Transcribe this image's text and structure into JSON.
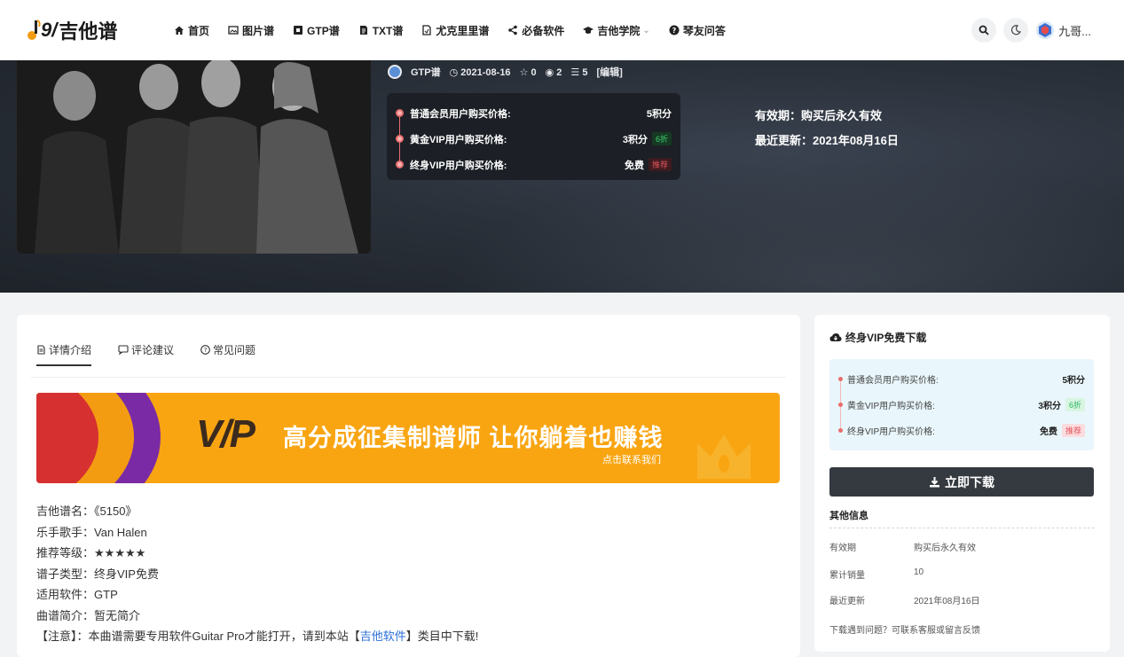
{
  "header": {
    "logo_text": "吉他谱",
    "nav": [
      {
        "label": "首页",
        "icon": "home-icon"
      },
      {
        "label": "图片谱",
        "icon": "image-icon"
      },
      {
        "label": "GTP谱",
        "icon": "gtp-icon"
      },
      {
        "label": "TXT谱",
        "icon": "file-text-icon"
      },
      {
        "label": "尤克里里谱",
        "icon": "file-icon"
      },
      {
        "label": "必备软件",
        "icon": "share-icon"
      },
      {
        "label": "吉他学院",
        "icon": "graduation-cap-icon",
        "dropdown": true
      },
      {
        "label": "琴友问答",
        "icon": "question-icon"
      }
    ],
    "user_name": "九哥..."
  },
  "hero": {
    "category": "GTP谱",
    "date": "2021-08-16",
    "stars": "0",
    "views": "2",
    "likes": "5",
    "edit": "[编辑]",
    "prices": [
      {
        "label": "普通会员用户购买价格:",
        "value": "5积分",
        "badge": ""
      },
      {
        "label": "黄金VIP用户购买价格:",
        "value": "3积分",
        "badge": "6折"
      },
      {
        "label": "终身VIP用户购买价格:",
        "value": "免费",
        "badge": "推荐"
      }
    ],
    "validity": "有效期：购买后永久有效",
    "updated": "最近更新：2021年08月16日"
  },
  "tabs": [
    {
      "label": "详情介绍",
      "icon": "document-icon"
    },
    {
      "label": "评论建议",
      "icon": "comment-icon"
    },
    {
      "label": "常见问题",
      "icon": "help-circle-icon"
    }
  ],
  "banner": {
    "logo": "V/P",
    "title": "高分成征集制谱师  让你躺着也赚钱",
    "subtitle": "点击联系我们"
  },
  "details": [
    {
      "k": "吉他谱名：",
      "v": "《5150》"
    },
    {
      "k": "乐手歌手：",
      "v": "Van Halen"
    },
    {
      "k": "推荐等级：",
      "v": "★★★★★"
    },
    {
      "k": "谱子类型：",
      "v": "终身VIP免费"
    },
    {
      "k": "适用软件：",
      "v": "GTP"
    },
    {
      "k": "曲谱简介：",
      "v": "暂无简介"
    }
  ],
  "notice": {
    "prefix": "【注意】：本曲谱需要专用软件Guitar Pro才能打开，请到本站【",
    "link": "吉他软件",
    "suffix": "】类目中下载!"
  },
  "sidebar": {
    "title": "终身VIP免费下载",
    "prices": [
      {
        "label": "普通会员用户购买价格:",
        "value": "5积分",
        "badge": ""
      },
      {
        "label": "黄金VIP用户购买价格:",
        "value": "3积分",
        "badge": "6折"
      },
      {
        "label": "终身VIP用户购买价格:",
        "value": "免费",
        "badge": "推荐"
      }
    ],
    "download_label": "立即下载",
    "other_title": "其他信息",
    "other": [
      {
        "k": "有效期",
        "v": "购买后永久有效"
      },
      {
        "k": "累计销量",
        "v": "10"
      },
      {
        "k": "最近更新",
        "v": "2021年08月16日"
      }
    ],
    "help": "下载遇到问题？可联系客服或留言反馈"
  },
  "colors": {
    "accent_red": "#e96d6d",
    "green_badge": "#3dd072",
    "banner_orange": "#f9a512",
    "dark_button": "#353a41"
  }
}
